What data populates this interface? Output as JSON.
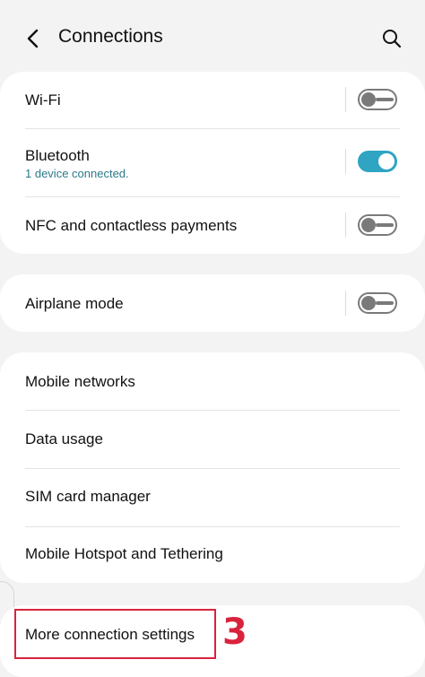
{
  "header": {
    "title": "Connections",
    "back_icon": "chevron-left-icon",
    "search_icon": "search-icon"
  },
  "groups": {
    "wireless": {
      "wifi": {
        "label": "Wi-Fi",
        "toggle": "off"
      },
      "bluetooth": {
        "label": "Bluetooth",
        "sub": "1 device connected.",
        "toggle": "on"
      },
      "nfc": {
        "label": "NFC and contactless payments",
        "toggle": "off"
      }
    },
    "airplane": {
      "label": "Airplane mode",
      "toggle": "off"
    },
    "network": {
      "mobile_networks": "Mobile networks",
      "data_usage": "Data usage",
      "sim_manager": "SIM card manager",
      "hotspot": "Mobile Hotspot and Tethering"
    },
    "more": {
      "label": "More connection settings"
    }
  },
  "annotation": {
    "step": "3",
    "color": "#d9233c"
  },
  "colors": {
    "accent": "#2fa4c3",
    "sub_text": "#2c7a88",
    "background": "#f3f3f3"
  }
}
